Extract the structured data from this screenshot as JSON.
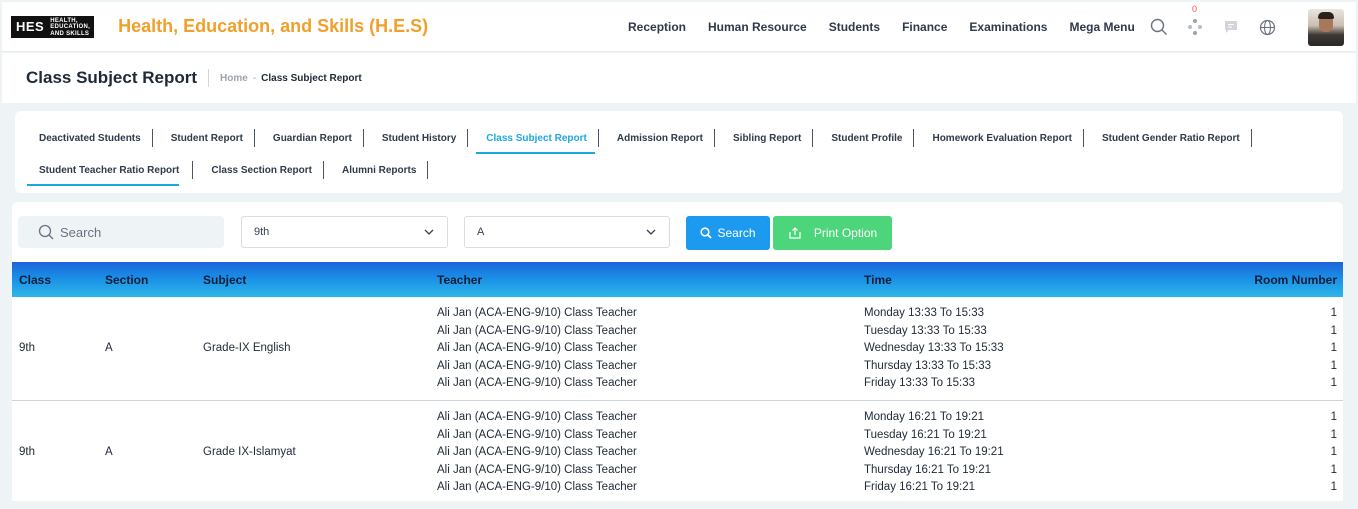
{
  "app": {
    "logo_mark": "HES",
    "logo_text": [
      "HEALTH,",
      "EDUCATION,",
      "AND SKILLS"
    ],
    "title": "Health, Education, and Skills (H.E.S)"
  },
  "nav": {
    "items": [
      "Reception",
      "Human Resource",
      "Students",
      "Finance",
      "Examinations",
      "Mega Menu"
    ],
    "notification_count": "0",
    "icons": [
      "search-icon",
      "apps-icon",
      "chat-icon",
      "globe-icon"
    ]
  },
  "page": {
    "title": "Class Subject Report",
    "breadcrumb_home": "Home",
    "breadcrumb_sep": "-",
    "breadcrumb_current": "Class Subject Report"
  },
  "tabs": {
    "row1": [
      "Deactivated Students",
      "Student Report",
      "Guardian Report",
      "Student History",
      "Class Subject Report",
      "Admission Report",
      "Sibling Report",
      "Student Profile",
      "Homework Evaluation Report",
      "Student Gender Ratio Report"
    ],
    "row2": [
      "Student Teacher Ratio Report",
      "Class Section Report",
      "Alumni Reports"
    ],
    "active_text": "Class Subject Report",
    "underlined_text": "Student Teacher Ratio Report"
  },
  "filters": {
    "search_placeholder": "Search",
    "class_value": "9th",
    "section_value": "A",
    "search_button": "Search",
    "print_button": "Print Option"
  },
  "table": {
    "headers": [
      "Class",
      "Section",
      "Subject",
      "Teacher",
      "Time",
      "Room Number"
    ],
    "rows": [
      {
        "class": "9th",
        "section": "A",
        "subject": "Grade-IX English",
        "teachers": [
          "Ali Jan (ACA-ENG-9/10) Class Teacher",
          "Ali Jan (ACA-ENG-9/10) Class Teacher",
          "Ali Jan (ACA-ENG-9/10) Class Teacher",
          "Ali Jan (ACA-ENG-9/10) Class Teacher",
          "Ali Jan (ACA-ENG-9/10) Class Teacher"
        ],
        "times": [
          "Monday 13:33 To 15:33",
          "Tuesday 13:33 To 15:33",
          "Wednesday 13:33 To 15:33",
          "Thursday 13:33 To 15:33",
          "Friday 13:33 To 15:33"
        ],
        "rooms": [
          "1",
          "1",
          "1",
          "1",
          "1"
        ]
      },
      {
        "class": "9th",
        "section": "A",
        "subject": "Grade IX-Islamyat",
        "teachers": [
          "Ali Jan (ACA-ENG-9/10) Class Teacher",
          "Ali Jan (ACA-ENG-9/10) Class Teacher",
          "Ali Jan (ACA-ENG-9/10) Class Teacher",
          "Ali Jan (ACA-ENG-9/10) Class Teacher",
          "Ali Jan (ACA-ENG-9/10) Class Teacher"
        ],
        "times": [
          "Monday 16:21 To 19:21",
          "Tuesday 16:21 To 19:21",
          "Wednesday 16:21 To 19:21",
          "Thursday 16:21 To 19:21",
          "Friday 16:21 To 19:21"
        ],
        "rooms": [
          "1",
          "1",
          "1",
          "1",
          "1"
        ]
      }
    ]
  },
  "colors": {
    "brand_title": "#f0a02a",
    "accent": "#1ea7e1",
    "search_button": "#1b9af0",
    "print_button": "#4cd57a",
    "badge": "#ff4d4f"
  }
}
